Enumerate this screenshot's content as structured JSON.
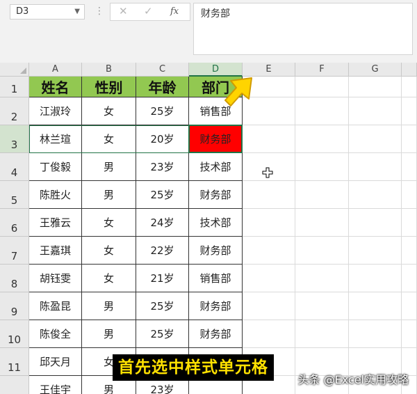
{
  "name_box": {
    "value": "D3"
  },
  "formula_bar": {
    "cancel_icon": "close-icon",
    "confirm_icon": "check-icon",
    "fx_label": "fx",
    "content": "财务部"
  },
  "grid": {
    "columns": [
      "A",
      "B",
      "C",
      "D",
      "E",
      "F",
      "G"
    ],
    "rows": [
      "1",
      "2",
      "3",
      "4",
      "5",
      "6",
      "7",
      "8",
      "9",
      "10",
      "11",
      ""
    ],
    "header": [
      "姓名",
      "性别",
      "年龄",
      "部门"
    ],
    "data": [
      [
        "江淑玲",
        "女",
        "25岁",
        "销售部"
      ],
      [
        "林兰瑄",
        "女",
        "20岁",
        "财务部"
      ],
      [
        "丁俊毅",
        "男",
        "23岁",
        "技术部"
      ],
      [
        "陈胜火",
        "男",
        "25岁",
        "财务部"
      ],
      [
        "王雅云",
        "女",
        "24岁",
        "技术部"
      ],
      [
        "王嘉琪",
        "女",
        "22岁",
        "财务部"
      ],
      [
        "胡钰雯",
        "女",
        "21岁",
        "销售部"
      ],
      [
        "陈盈昆",
        "男",
        "25岁",
        "财务部"
      ],
      [
        "陈俊全",
        "男",
        "25岁",
        "财务部"
      ],
      [
        "邱天月",
        "女",
        "",
        ""
      ],
      [
        "王佳宇",
        "男",
        "23岁",
        ""
      ]
    ]
  },
  "colors": {
    "header_fill": "#92c851",
    "highlight_fill": "#ff0000",
    "selection": "#217346",
    "banner_text": "#ffe100"
  },
  "banner": {
    "text": "首先选中样式单元格"
  },
  "watermark": {
    "text": "头条 @Excel实用攻略"
  }
}
